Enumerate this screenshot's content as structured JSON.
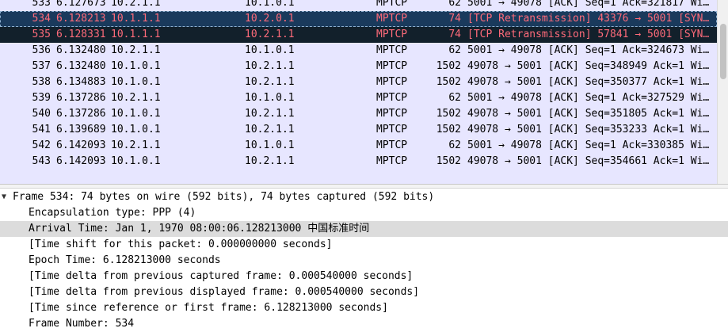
{
  "packet_list": {
    "rows": [
      {
        "no": "533",
        "time": "6.127673",
        "src": "10.2.1.1",
        "dst": "10.1.0.1",
        "proto": "MPTCP",
        "len": "62",
        "info": "5001 → 49078 [ACK] Seq=1 Ack=321817 Wi…",
        "state": "normal"
      },
      {
        "no": "534",
        "time": "6.128213",
        "src": "10.1.1.1",
        "dst": "10.2.0.1",
        "proto": "MPTCP",
        "len": "74",
        "info": "[TCP Retransmission] 43376 → 5001 [SYN…",
        "state": "selected"
      },
      {
        "no": "535",
        "time": "6.128331",
        "src": "10.1.1.1",
        "dst": "10.2.1.1",
        "proto": "MPTCP",
        "len": "74",
        "info": "[TCP Retransmission] 57841 → 5001 [SYN…",
        "state": "marked"
      },
      {
        "no": "536",
        "time": "6.132480",
        "src": "10.2.1.1",
        "dst": "10.1.0.1",
        "proto": "MPTCP",
        "len": "62",
        "info": "5001 → 49078 [ACK] Seq=1 Ack=324673 Wi…",
        "state": "normal"
      },
      {
        "no": "537",
        "time": "6.132480",
        "src": "10.1.0.1",
        "dst": "10.2.1.1",
        "proto": "MPTCP",
        "len": "1502",
        "info": "49078 → 5001 [ACK] Seq=348949 Ack=1 Wi…",
        "state": "normal"
      },
      {
        "no": "538",
        "time": "6.134883",
        "src": "10.1.0.1",
        "dst": "10.2.1.1",
        "proto": "MPTCP",
        "len": "1502",
        "info": "49078 → 5001 [ACK] Seq=350377 Ack=1 Wi…",
        "state": "normal"
      },
      {
        "no": "539",
        "time": "6.137286",
        "src": "10.2.1.1",
        "dst": "10.1.0.1",
        "proto": "MPTCP",
        "len": "62",
        "info": "5001 → 49078 [ACK] Seq=1 Ack=327529 Wi…",
        "state": "normal"
      },
      {
        "no": "540",
        "time": "6.137286",
        "src": "10.1.0.1",
        "dst": "10.2.1.1",
        "proto": "MPTCP",
        "len": "1502",
        "info": "49078 → 5001 [ACK] Seq=351805 Ack=1 Wi…",
        "state": "normal"
      },
      {
        "no": "541",
        "time": "6.139689",
        "src": "10.1.0.1",
        "dst": "10.2.1.1",
        "proto": "MPTCP",
        "len": "1502",
        "info": "49078 → 5001 [ACK] Seq=353233 Ack=1 Wi…",
        "state": "normal"
      },
      {
        "no": "542",
        "time": "6.142093",
        "src": "10.2.1.1",
        "dst": "10.1.0.1",
        "proto": "MPTCP",
        "len": "62",
        "info": "5001 → 49078 [ACK] Seq=1 Ack=330385 Wi…",
        "state": "normal"
      },
      {
        "no": "543",
        "time": "6.142093",
        "src": "10.1.0.1",
        "dst": "10.2.1.1",
        "proto": "MPTCP",
        "len": "1502",
        "info": "49078 → 5001 [ACK] Seq=354661 Ack=1 Wi…",
        "state": "normal"
      }
    ]
  },
  "details": {
    "frame_header": "Frame 534: 74 bytes on wire (592 bits), 74 bytes captured (592 bits)",
    "items": [
      {
        "text": "Encapsulation type: PPP (4)",
        "highlighted": false
      },
      {
        "text": "Arrival Time: Jan  1, 1970 08:00:06.128213000 中国标准时间",
        "highlighted": true
      },
      {
        "text": "[Time shift for this packet: 0.000000000 seconds]",
        "highlighted": false
      },
      {
        "text": "Epoch Time: 6.128213000 seconds",
        "highlighted": false
      },
      {
        "text": "[Time delta from previous captured frame: 0.000540000 seconds]",
        "highlighted": false
      },
      {
        "text": "[Time delta from previous displayed frame: 0.000540000 seconds]",
        "highlighted": false
      },
      {
        "text": "[Time since reference or first frame: 6.128213000 seconds]",
        "highlighted": false
      },
      {
        "text": "Frame Number: 534",
        "highlighted": false
      }
    ]
  },
  "icons": {
    "expand": "caret-down-icon"
  },
  "colors": {
    "list_bg": "#e7e6ff",
    "selected_bg": "#1a3a5c",
    "marked_bg": "#12202b",
    "selected_fg": "#ff6b7a",
    "detail_highlight": "#dcdcdc"
  }
}
